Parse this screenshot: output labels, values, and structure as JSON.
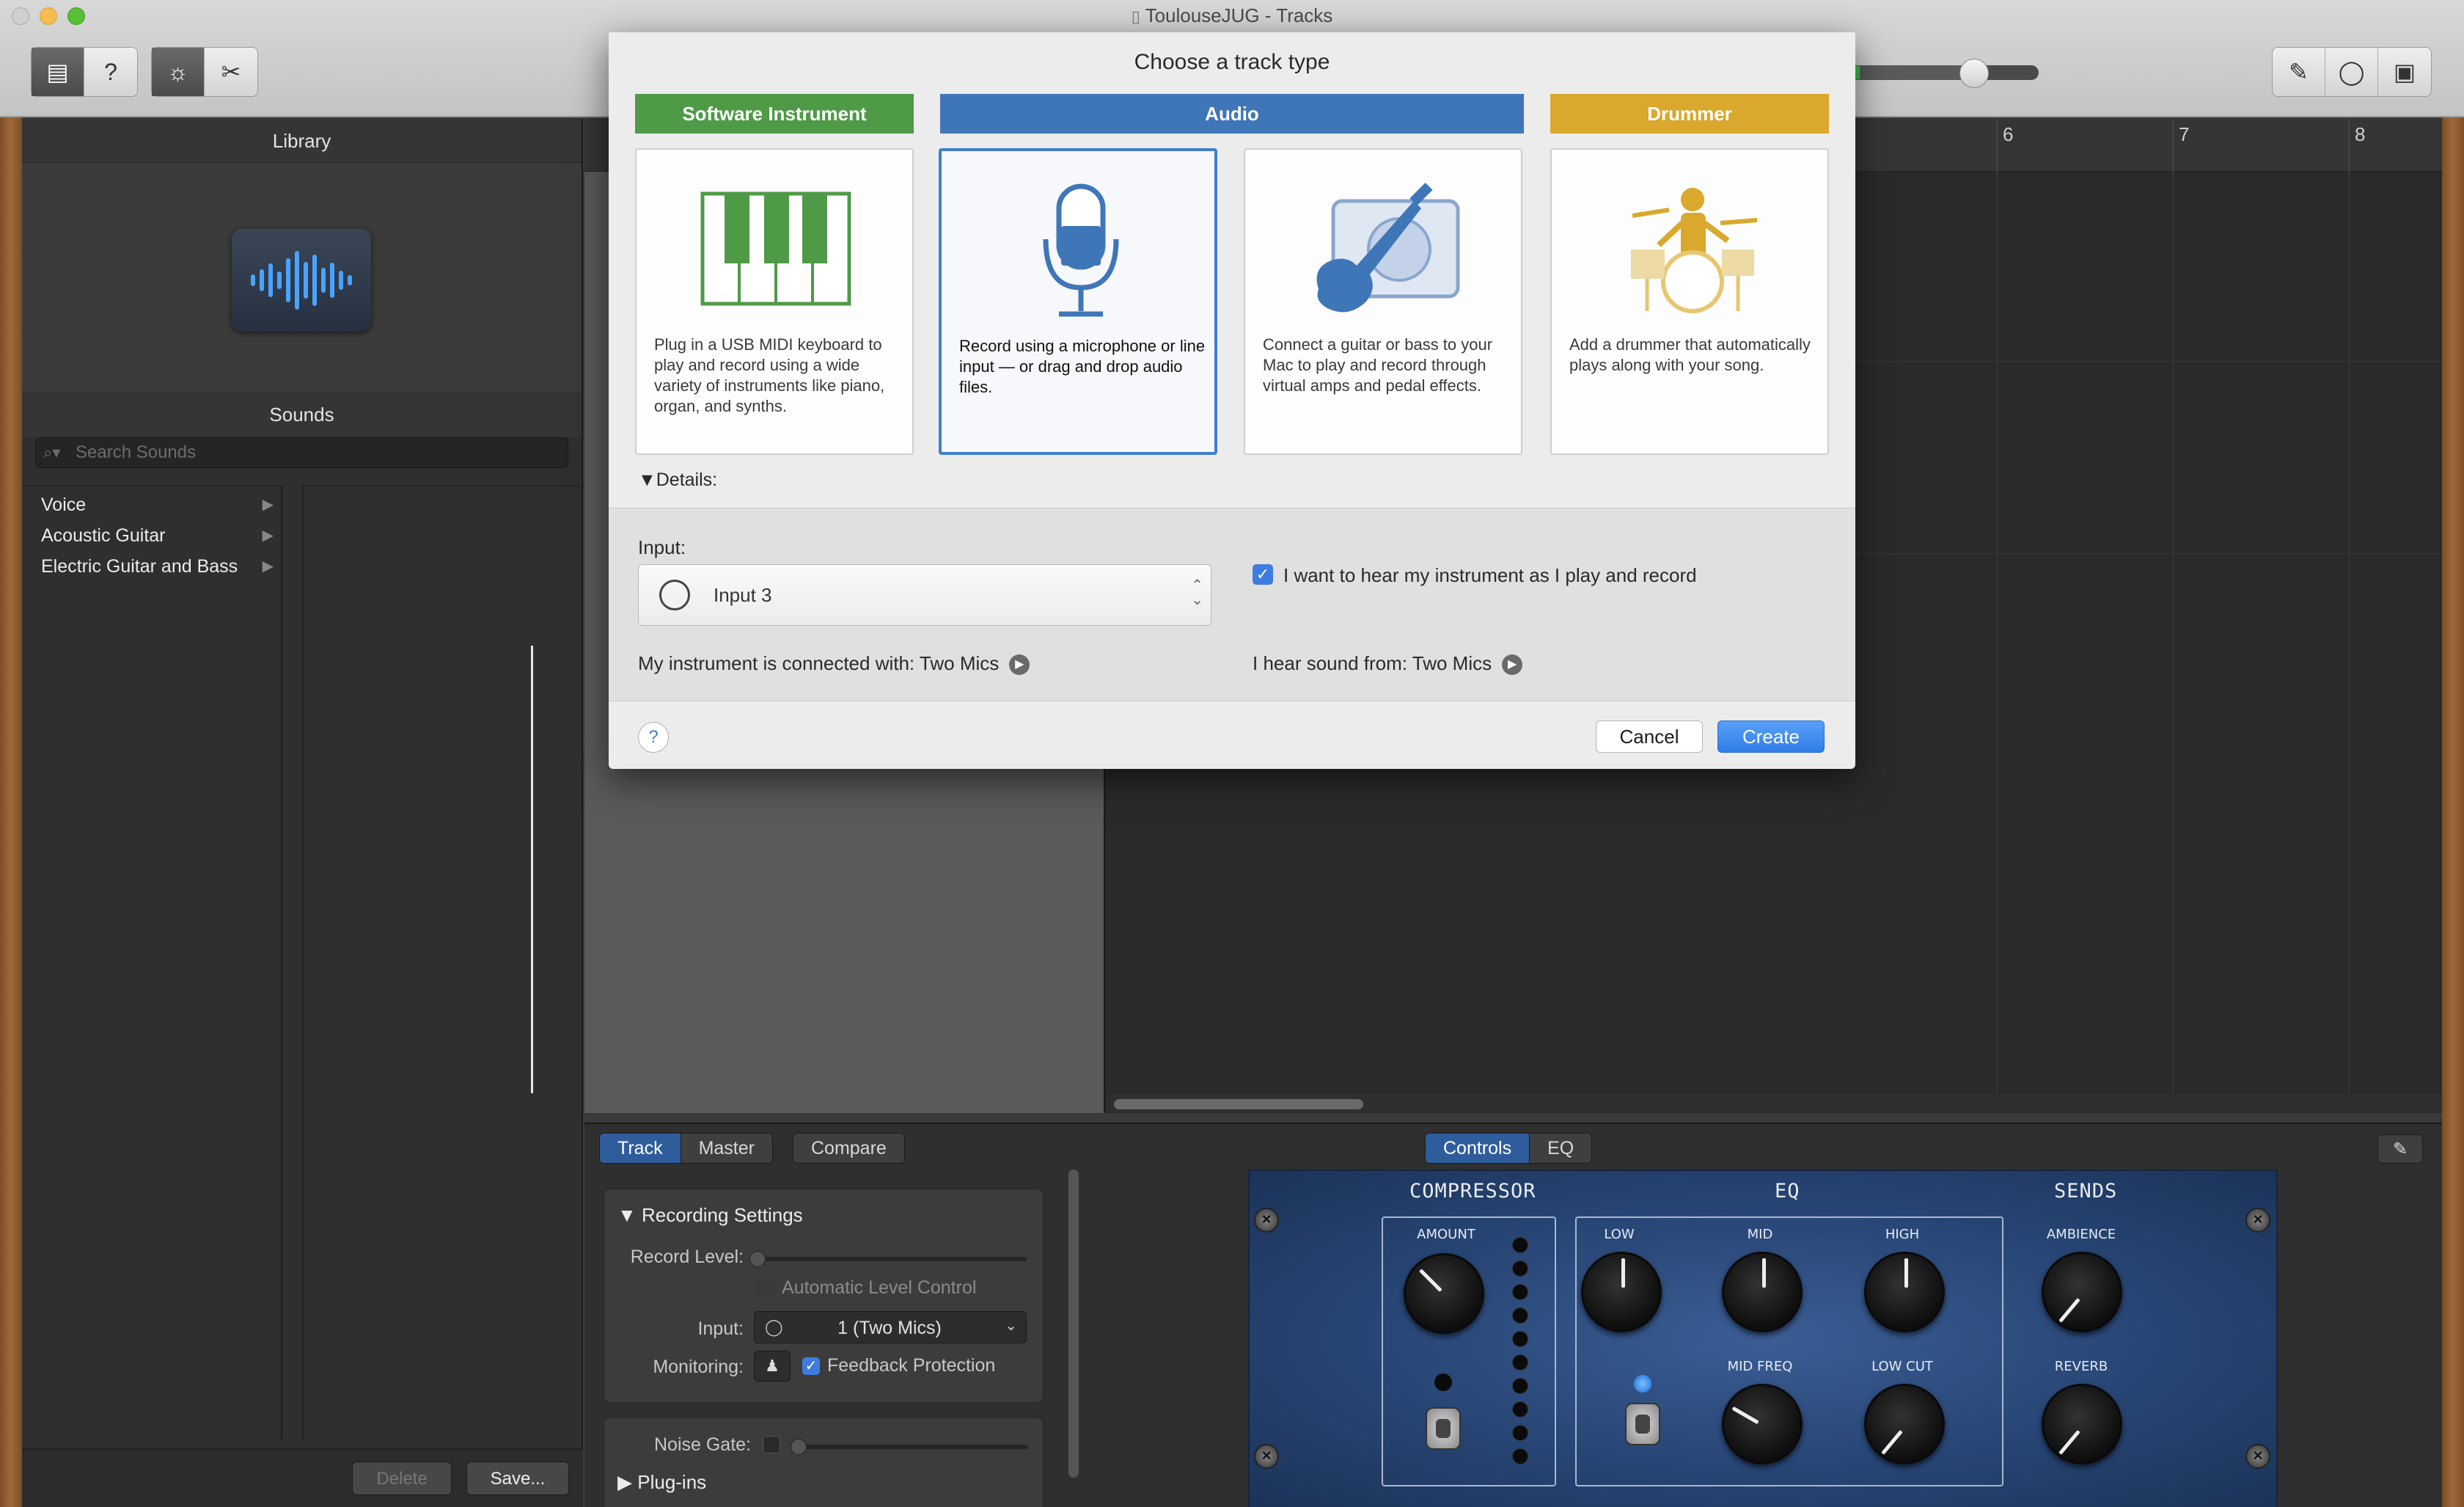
{
  "window": {
    "title": "ToulouseJUG - Tracks"
  },
  "toolbar": {
    "left_group_1": [
      "library-icon",
      "help-icon"
    ],
    "left_group_2": [
      "smart-controls-icon",
      "scissors-icon"
    ],
    "right_group": [
      "notepad-icon",
      "loops-icon",
      "media-browser-icon"
    ]
  },
  "library": {
    "header": "Library",
    "sounds_header": "Sounds",
    "search_placeholder": "Search Sounds",
    "items": [
      "Voice",
      "Acoustic Guitar",
      "Electric Guitar and Bass"
    ],
    "delete_label": "Delete",
    "save_label": "Save..."
  },
  "ruler": {
    "marks": [
      "6",
      "7",
      "8"
    ]
  },
  "smart_controls": {
    "left_tabs": [
      "Track",
      "Master",
      "Compare"
    ],
    "center_tabs": [
      "Controls",
      "EQ"
    ],
    "recording_settings_title": "Recording Settings",
    "record_level_label": "Record Level:",
    "auto_level_label": "Automatic Level Control",
    "input_label": "Input:",
    "input_value": "1  (Two Mics)",
    "monitoring_label": "Monitoring:",
    "feedback_label": "Feedback Protection",
    "noise_gate_label": "Noise Gate:",
    "plugins_label": "Plug-ins",
    "amp": {
      "compressor_title": "COMPRESSOR",
      "eq_title": "EQ",
      "sends_title": "SENDS",
      "amount_label": "AMOUNT",
      "low_label": "LOW",
      "mid_label": "MID",
      "high_label": "HIGH",
      "mid_freq_label": "MID FREQ",
      "low_cut_label": "LOW CUT",
      "ambience_label": "AMBIENCE",
      "reverb_label": "REVERB"
    }
  },
  "dialog": {
    "title": "Choose a track type",
    "categories": [
      {
        "label": "Software Instrument",
        "color": "#4f9a47"
      },
      {
        "label": "Audio",
        "color": "#3f76b8"
      },
      {
        "label": "Drummer",
        "color": "#d9a82c"
      }
    ],
    "tiles": [
      "Plug in a USB MIDI keyboard to play and record using a wide variety of instruments like piano, organ, and synths.",
      "Record using a microphone or line input — or drag and drop audio files.",
      "Connect a guitar or bass to your Mac to play and record through virtual amps and pedal effects.",
      "Add a drummer that automatically plays along with your song."
    ],
    "details_label": "Details:",
    "input_label": "Input:",
    "input_value": "Input 3",
    "monitor_label": "I want to hear my instrument as I play and record",
    "connected_label": "My instrument is connected with: Two Mics",
    "hear_label": "I hear sound from: Two Mics",
    "help_label": "?",
    "cancel_label": "Cancel",
    "create_label": "Create"
  }
}
